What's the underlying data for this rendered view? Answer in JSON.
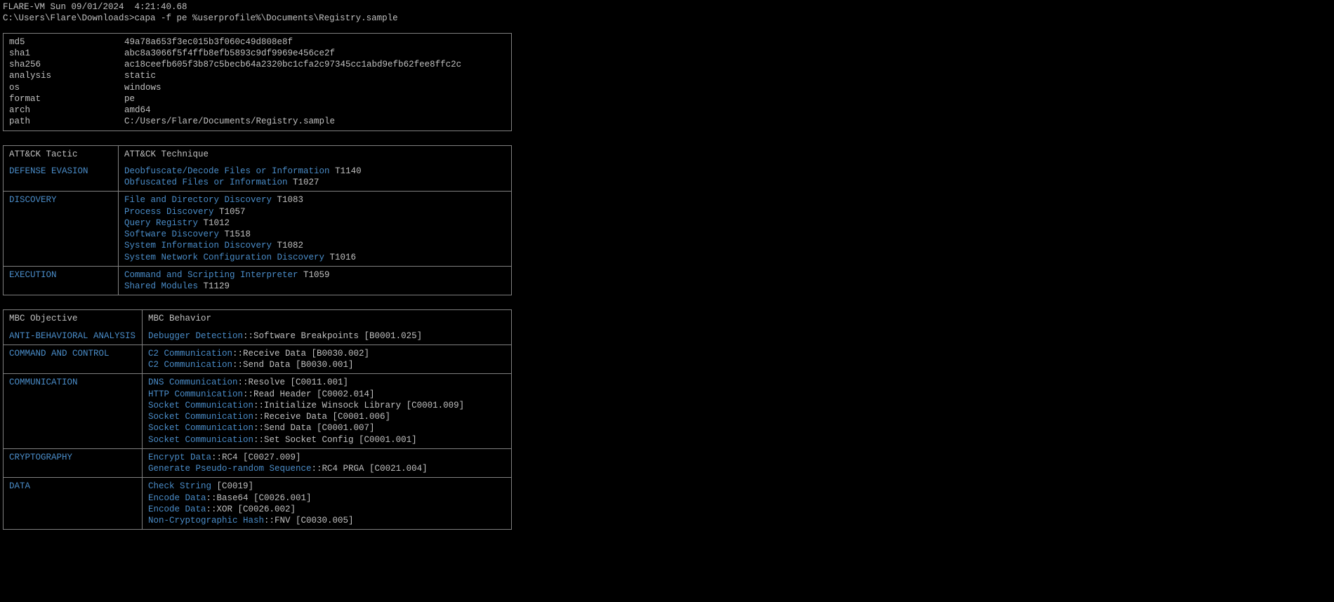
{
  "terminal": {
    "host_line": "FLARE-VM Sun 09/01/2024  4:21:40.68",
    "prompt": "C:\\Users\\Flare\\Downloads>",
    "command": "capa -f pe %userprofile%\\Documents\\Registry.sample"
  },
  "info": {
    "rows": [
      {
        "key": "md5",
        "val": "49a78a653f3ec015b3f060c49d808e8f"
      },
      {
        "key": "sha1",
        "val": "abc8a3066f5f4ffb8efb5893c9df9969e456ce2f"
      },
      {
        "key": "sha256",
        "val": "ac18ceefb605f3b87c5becb64a2320bc1cfa2c97345cc1abd9efb62fee8ffc2c"
      },
      {
        "key": "analysis",
        "val": "static"
      },
      {
        "key": "os",
        "val": "windows"
      },
      {
        "key": "format",
        "val": "pe"
      },
      {
        "key": "arch",
        "val": "amd64"
      },
      {
        "key": "path",
        "val": "C:/Users/Flare/Documents/Registry.sample"
      }
    ]
  },
  "attack": {
    "header_left": "ATT&CK Tactic",
    "header_right": "ATT&CK Technique",
    "rows": [
      {
        "tactic": "DEFENSE EVASION",
        "techniques": [
          {
            "name": "Deobfuscate/Decode Files or Information",
            "code": " T1140"
          },
          {
            "name": "Obfuscated Files or Information",
            "code": " T1027"
          }
        ]
      },
      {
        "tactic": "DISCOVERY",
        "techniques": [
          {
            "name": "File and Directory Discovery",
            "code": " T1083"
          },
          {
            "name": "Process Discovery",
            "code": " T1057"
          },
          {
            "name": "Query Registry",
            "code": " T1012"
          },
          {
            "name": "Software Discovery",
            "code": " T1518"
          },
          {
            "name": "System Information Discovery",
            "code": " T1082"
          },
          {
            "name": "System Network Configuration Discovery",
            "code": " T1016"
          }
        ]
      },
      {
        "tactic": "EXECUTION",
        "techniques": [
          {
            "name": "Command and Scripting Interpreter",
            "code": " T1059"
          },
          {
            "name": "Shared Modules",
            "code": " T1129"
          }
        ]
      }
    ]
  },
  "mbc": {
    "header_left": "MBC Objective",
    "header_right": "MBC Behavior",
    "rows": [
      {
        "objective": "ANTI-BEHAVIORAL ANALYSIS",
        "behaviors": [
          {
            "name": "Debugger Detection",
            "suffix": "::Software Breakpoints [B0001.025]"
          }
        ]
      },
      {
        "objective": "COMMAND AND CONTROL",
        "behaviors": [
          {
            "name": "C2 Communication",
            "suffix": "::Receive Data [B0030.002]"
          },
          {
            "name": "C2 Communication",
            "suffix": "::Send Data [B0030.001]"
          }
        ]
      },
      {
        "objective": "COMMUNICATION",
        "behaviors": [
          {
            "name": "DNS Communication",
            "suffix": "::Resolve [C0011.001]"
          },
          {
            "name": "HTTP Communication",
            "suffix": "::Read Header [C0002.014]"
          },
          {
            "name": "Socket Communication",
            "suffix": "::Initialize Winsock Library [C0001.009]"
          },
          {
            "name": "Socket Communication",
            "suffix": "::Receive Data [C0001.006]"
          },
          {
            "name": "Socket Communication",
            "suffix": "::Send Data [C0001.007]"
          },
          {
            "name": "Socket Communication",
            "suffix": "::Set Socket Config [C0001.001]"
          }
        ]
      },
      {
        "objective": "CRYPTOGRAPHY",
        "behaviors": [
          {
            "name": "Encrypt Data",
            "suffix": "::RC4 [C0027.009]"
          },
          {
            "name": "Generate Pseudo-random Sequence",
            "suffix": "::RC4 PRGA [C0021.004]"
          }
        ]
      },
      {
        "objective": "DATA",
        "behaviors": [
          {
            "name": "Check String",
            "suffix": " [C0019]"
          },
          {
            "name": "Encode Data",
            "suffix": "::Base64 [C0026.001]"
          },
          {
            "name": "Encode Data",
            "suffix": "::XOR [C0026.002]"
          },
          {
            "name": "Non-Cryptographic Hash",
            "suffix": "::FNV [C0030.005]"
          }
        ]
      }
    ]
  }
}
